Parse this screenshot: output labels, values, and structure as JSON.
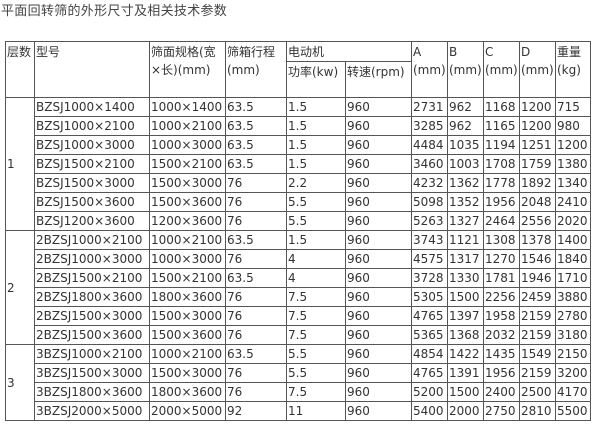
{
  "caption": "平面回转筛的外形尺寸及相关技术参数",
  "headers": {
    "layer": "层数",
    "model": "型号",
    "spec": "筛面规格(宽×长)(mm)",
    "stroke": "筛箱行程(mm)",
    "motor": "电动机",
    "power": "功率(kw)",
    "speed": "转速(rpm)",
    "a": "A (mm)",
    "b": "B (mm)",
    "c": "C (mm)",
    "d": "D (mm)",
    "weight": "重量(kg)"
  },
  "groups": [
    {
      "layer": "1",
      "rows": [
        [
          "BZSJ1000×1400",
          "1000×1400",
          "63.5",
          "1.5",
          "960",
          "2731",
          "962",
          "1168",
          "1200",
          "715"
        ],
        [
          "BZSJ1000×2100",
          "1000×2100",
          "63.5",
          "1.5",
          "960",
          "3285",
          "962",
          "1165",
          "1200",
          "980"
        ],
        [
          "BZSJ1000×3000",
          "1000×3000",
          "63.5",
          "1.5",
          "960",
          "4484",
          "1035",
          "1194",
          "1251",
          "1200"
        ],
        [
          "BZSJ1500×2100",
          "1500×2100",
          "63.5",
          "1.5",
          "960",
          "3460",
          "1003",
          "1708",
          "1759",
          "1380"
        ],
        [
          "BZSJ1500×3000",
          "1500×3000",
          "76",
          "2.2",
          "960",
          "4232",
          "1362",
          "1778",
          "1892",
          "1340"
        ],
        [
          "BZSJ1500×3600",
          "1500×3600",
          "76",
          "5.5",
          "960",
          "5098",
          "1352",
          "1956",
          "2048",
          "2410"
        ],
        [
          "BZSJ1200×3600",
          "1200×3600",
          "76",
          "5.5",
          "960",
          "5263",
          "1327",
          "2464",
          "2556",
          "2020"
        ]
      ]
    },
    {
      "layer": "2",
      "rows": [
        [
          "2BZSJ1000×2100",
          "1000×2100",
          "63.5",
          "1.5",
          "960",
          "3743",
          "1121",
          "1308",
          "1378",
          "1400"
        ],
        [
          "2BZSJ1000×3000",
          "1000×3000",
          "76",
          "4",
          "960",
          "4575",
          "1317",
          "1270",
          "1546",
          "1840"
        ],
        [
          "2BZSJ1500×2100",
          "1500×2100",
          "63.5",
          "4",
          "960",
          "3728",
          "1330",
          "1781",
          "1946",
          "1710"
        ],
        [
          "2BZSJ1800×3600",
          "1800×3600",
          "76",
          "7.5",
          "960",
          "5305",
          "1500",
          "2256",
          "2459",
          "3880"
        ],
        [
          "2BZSJ1500×3000",
          "1500×3000",
          "76",
          "7.5",
          "960",
          "4765",
          "1397",
          "1958",
          "2159",
          "2780"
        ],
        [
          "2BZSJ1500×3600",
          "1500×3600",
          "76",
          "7.5",
          "960",
          "5365",
          "1368",
          "2032",
          "2159",
          "3180"
        ]
      ]
    },
    {
      "layer": "3",
      "rows": [
        [
          "3BZSJ1000×2100",
          "1000×2100",
          "63.5",
          "5.5",
          "960",
          "4854",
          "1422",
          "1435",
          "1549",
          "2150"
        ],
        [
          "3BZSJ1500×3000",
          "1500×3000",
          "76",
          "5.5",
          "960",
          "4765",
          "1391",
          "1956",
          "2159",
          "3200"
        ],
        [
          "3BZSJ1800×3600",
          "1800×3600",
          "76",
          "7.5",
          "960",
          "5200",
          "1500",
          "2400",
          "2500",
          "4170"
        ],
        [
          "3BZSJ2000×5000",
          "2000×5000",
          "92",
          "11",
          "960",
          "5400",
          "2000",
          "2750",
          "2810",
          "5500"
        ]
      ]
    }
  ]
}
